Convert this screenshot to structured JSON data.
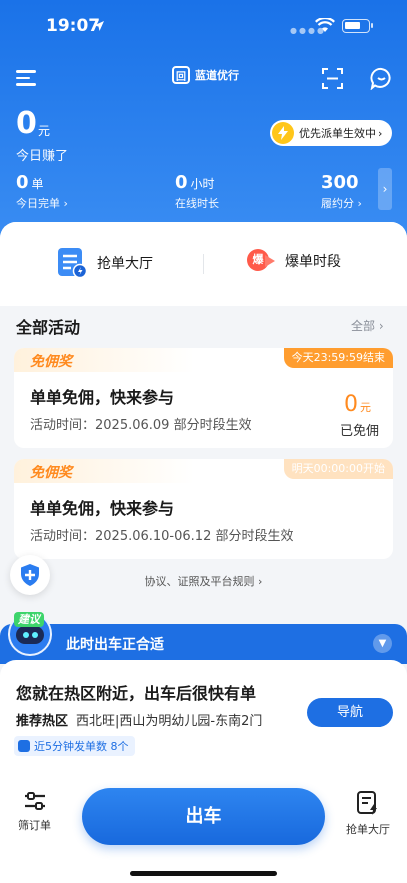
{
  "status_bar": {
    "time": "19:07"
  },
  "nav": {
    "brand_logo_char": "回",
    "brand_name": "蓝道优行"
  },
  "earnings": {
    "value": "0",
    "unit": "元",
    "label": "今日赚了"
  },
  "priority": {
    "text": "优先派单生效中",
    "arrow": "›"
  },
  "stats": [
    {
      "value": "0",
      "unit": "单",
      "label": "今日完单 ›"
    },
    {
      "value": "0",
      "unit": "小时",
      "label": "在线时长"
    },
    {
      "value": "300",
      "unit": "",
      "label": "履约分 ›"
    }
  ],
  "stats_more": "›",
  "quick": {
    "grab_hall": "抢单大厅",
    "burst_badge": "爆",
    "burst_period": "爆单时段"
  },
  "activities_section": {
    "title": "全部活动",
    "more": "全部 ›"
  },
  "activities": [
    {
      "tag": "免佣奖",
      "badge": "今天23:59:59结束",
      "title": "单单免佣，快来参与",
      "time": "活动时间：2025.06.09 部分时段生效",
      "amount": "0",
      "amount_unit": "元",
      "status": "已免佣"
    },
    {
      "tag": "免佣奖",
      "badge": "明天00:00:00开始",
      "title": "单单免佣，快来参与",
      "time": "活动时间：2025.06.10-06.12 部分时段生效"
    }
  ],
  "footer_link": "协议、证照及平台规则 ›",
  "suggestion": {
    "tag": "建议",
    "title": "此时出车正合适"
  },
  "sheet": {
    "title": "您就在热区附近，出车后很快有单",
    "hot_label": "推荐热区",
    "hot_value": "西北旺|西山为明幼儿园-东南2门",
    "nav_button": "导航",
    "chip": "近5分钟发单数 8个"
  },
  "bottom": {
    "filter": "筛订单",
    "go": "出车",
    "grab_hall": "抢单大厅"
  },
  "colors": {
    "primary": "#1e6fe3",
    "accent": "#ff8a1f"
  }
}
